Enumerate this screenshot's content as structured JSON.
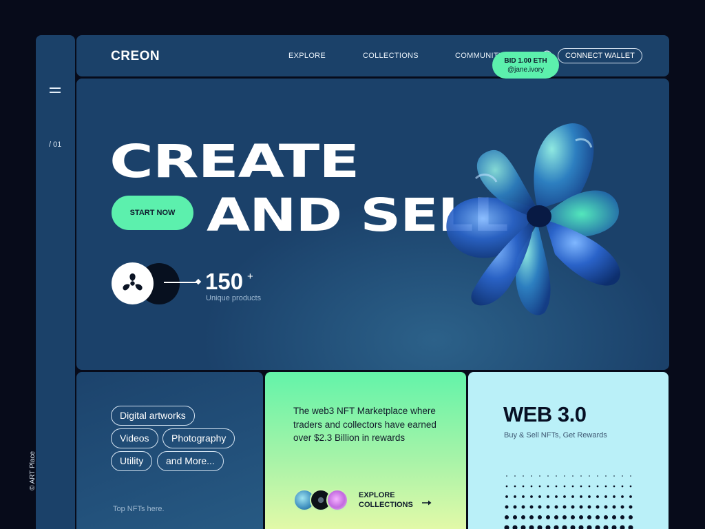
{
  "rail": {
    "page_index": "/ 01",
    "copyright": "© ART Place"
  },
  "header": {
    "logo": "CREON",
    "nav": [
      "EXPLORE",
      "COLLECTIONS",
      "COMMUNITY"
    ],
    "connect_label": "CONNECT WALLET"
  },
  "hero": {
    "line1": "CREATE",
    "line2": "AND SELL",
    "cta": "START NOW",
    "count": "150",
    "count_suffix": "+",
    "count_label": "Unique products",
    "bid": {
      "amount": "BID 1.00 ETH",
      "handle": "@jane.ivory"
    }
  },
  "tags": {
    "items": [
      "Digital artworks",
      "Videos",
      "Photography",
      "Utility",
      "and More..."
    ],
    "footer": "Top NFTs here."
  },
  "market": {
    "text": "The web3 NFT Marketplace where traders and collectors have earned over $2.3 Billion in rewards",
    "explore_line1": "EXPLORE",
    "explore_line2": "COLLECTIONS"
  },
  "web3": {
    "title": "WEB 3.0",
    "subtitle": "Buy & Sell NFTs, Get Rewards"
  },
  "colors": {
    "background": "#070b1a",
    "panel": "#1b4169",
    "accent_green": "#5cf0ad",
    "card_cyan": "#baf0f8"
  },
  "icons": [
    "menu-icon",
    "globe-icon",
    "logo-icon",
    "arrow-right-icon"
  ]
}
